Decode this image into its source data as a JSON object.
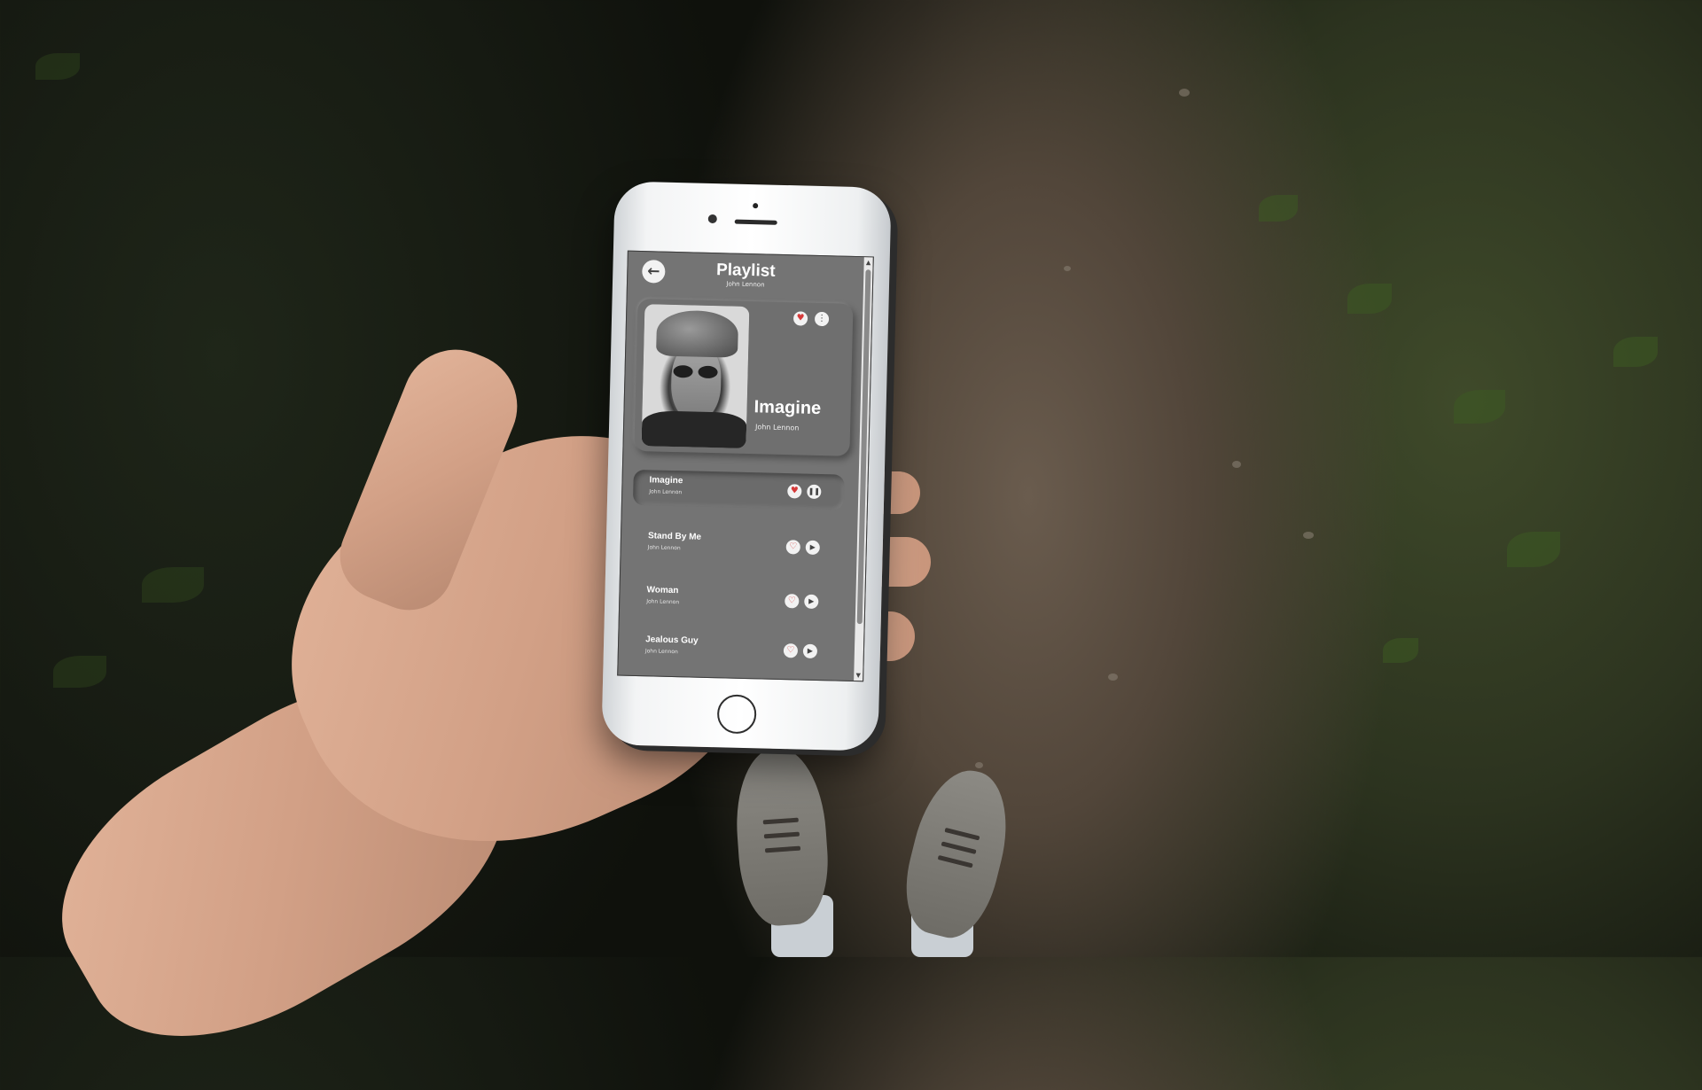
{
  "header": {
    "title": "Playlist",
    "subtitle": "John Lennon",
    "back_icon": "arrow-left-icon"
  },
  "now_playing": {
    "title": "Imagine",
    "artist": "John Lennon",
    "favorited": true,
    "icons": [
      "heart-icon",
      "more-vertical-icon"
    ]
  },
  "songs": [
    {
      "title": "Imagine",
      "artist": "John Lennon",
      "favorited": true,
      "state": "playing"
    },
    {
      "title": "Stand By Me",
      "artist": "John Lennon",
      "favorited": false,
      "state": "paused"
    },
    {
      "title": "Woman",
      "artist": "John Lennon",
      "favorited": false,
      "state": "paused"
    },
    {
      "title": "Jealous Guy",
      "artist": "John Lennon",
      "favorited": false,
      "state": "paused"
    }
  ],
  "colors": {
    "screen_bg": "#747474",
    "heart": "#d63a3a",
    "button_bg": "#f2f2f2"
  }
}
